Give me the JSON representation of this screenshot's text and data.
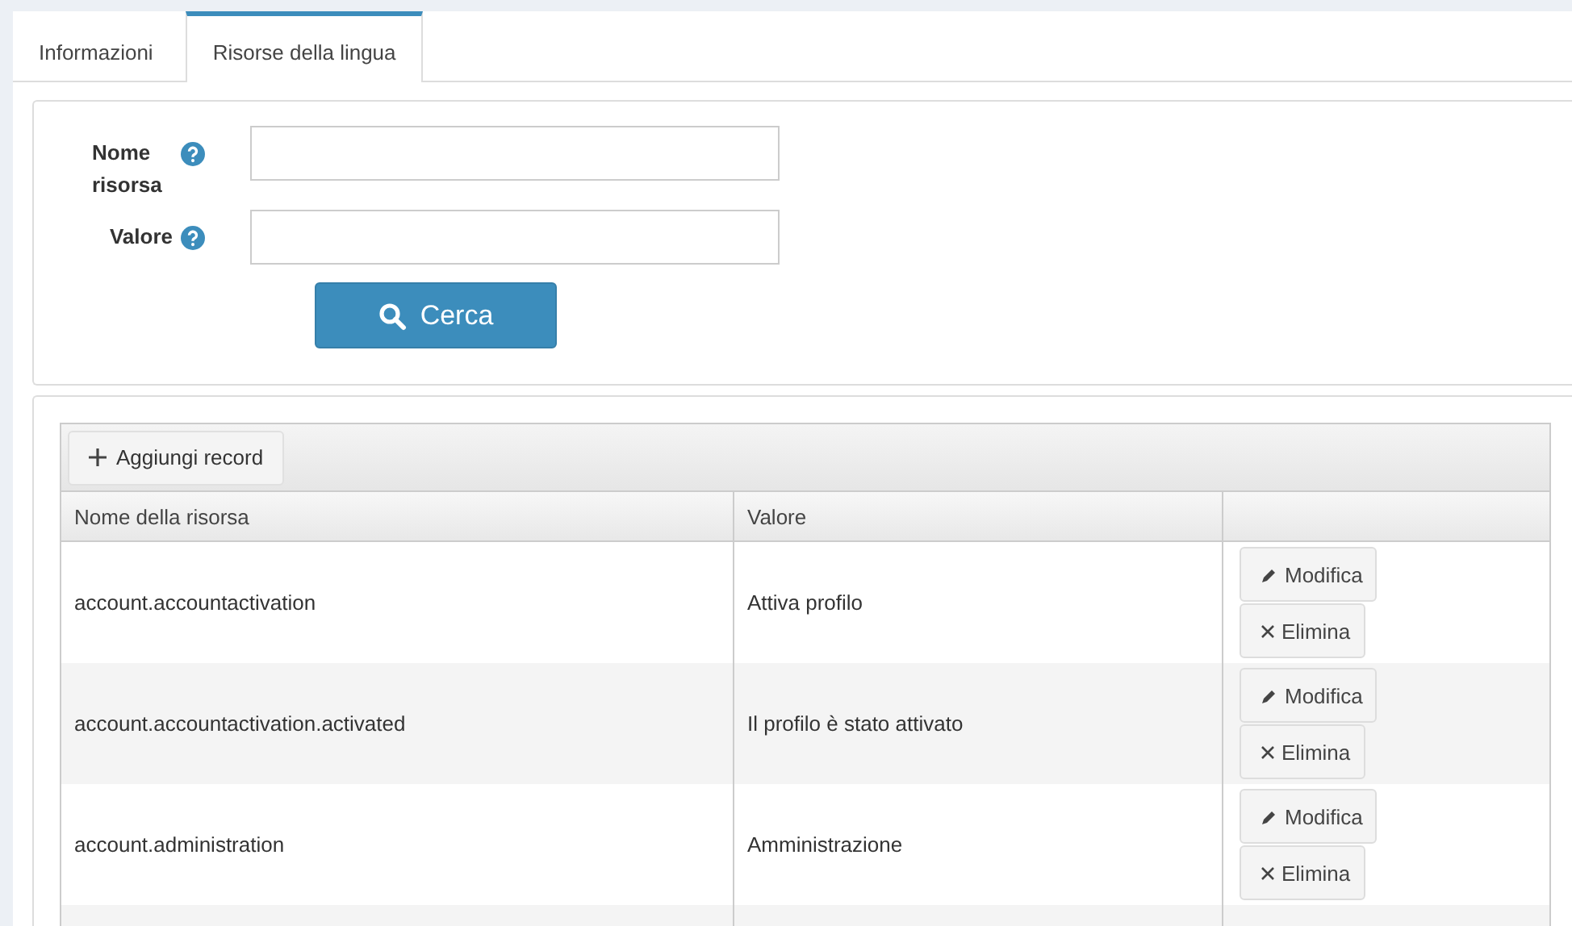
{
  "tabs": [
    {
      "label": "Informazioni",
      "selected": false
    },
    {
      "label": "Risorse della lingua",
      "selected": true
    }
  ],
  "search": {
    "fields": [
      {
        "label": "Nome risorsa"
      },
      {
        "label": "Valore"
      }
    ],
    "button": "Cerca"
  },
  "table": {
    "toolbar_button": "Aggiungi record",
    "columns": [
      "Nome della risorsa",
      "Valore"
    ],
    "rows": [
      {
        "name": "account.accountactivation",
        "value": "Attiva profilo",
        "actions": [
          "Modifica",
          "Elimina"
        ]
      },
      {
        "name": "account.accountactivation.activated",
        "value": "Il profilo è stato attivato",
        "actions": [
          "Modifica",
          "Elimina"
        ]
      },
      {
        "name": "account.administration",
        "value": "Amministrazione",
        "actions": [
          "Modifica",
          "Elimina"
        ]
      }
    ]
  }
}
